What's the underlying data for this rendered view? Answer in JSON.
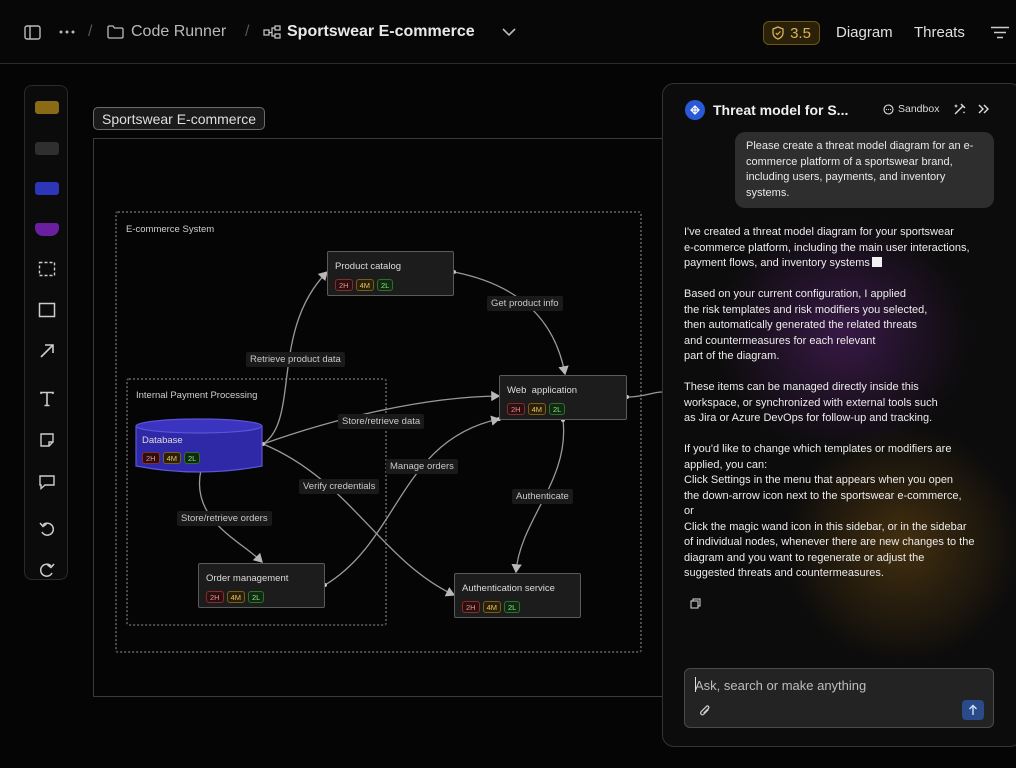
{
  "breadcrumb": {
    "workspace": "Code Runner",
    "project": "Sportswear E-commerce"
  },
  "header": {
    "score": "3.5",
    "nav_diagram": "Diagram",
    "nav_threats": "Threats"
  },
  "toolbar": {
    "swatch_colors": [
      "#8a6a14",
      "#2f2f2f",
      "#2d35b8",
      "#6a1fa0"
    ]
  },
  "canvas": {
    "frame_label": "Sportswear E-commerce",
    "boundaries": {
      "ecommerce": "E-commerce System",
      "payment": "Internal Payment Processing"
    },
    "nodes": {
      "product_catalog": {
        "title": "Product catalog",
        "high": "2H",
        "medium": "4M",
        "low": "2L"
      },
      "web_application": {
        "title": "Web  application",
        "high": "2H",
        "medium": "4M",
        "low": "2L"
      },
      "database": {
        "title": "Database",
        "high": "2H",
        "medium": "4M",
        "low": "2L"
      },
      "order_management": {
        "title": "Order management",
        "high": "2H",
        "medium": "4M",
        "low": "2L"
      },
      "authentication_service": {
        "title": "Authentication service",
        "high": "2H",
        "medium": "4M",
        "low": "2L"
      }
    },
    "edges": {
      "retrieve_product_data": "Retrieve product data",
      "get_product_info": "Get product info",
      "store_retrieve_data": "Store/retrieve data",
      "manage_orders": "Manage orders",
      "verify_credentials": "Verify credentials",
      "authenticate": "Authenticate",
      "store_retrieve_orders": "Store/retrieve orders"
    }
  },
  "chat": {
    "title": "Threat model for S...",
    "sandbox_label": "Sandbox",
    "user_message": "Please create a threat model diagram for an e-commerce platform of a sportswear brand, including users, payments, and inventory systems.",
    "reply": {
      "p1": [
        "I've created a threat model diagram for your sportswear",
        "e-commerce platform, including the main user interactions,",
        "payment flows, and inventory systems"
      ],
      "p2": [
        "Based on your current configuration, I applied",
        "the risk templates and risk modifiers you selected,",
        "then automatically generated the related threats",
        "and countermeasures for each relevant",
        "part of the diagram."
      ],
      "p3": [
        "These items can be managed directly inside this",
        "workspace, or synchronized with external tools such",
        "as Jira or Azure DevOps for follow-up and tracking."
      ],
      "p4": [
        "If you'd like to change which templates or modifiers are",
        "applied, you can:",
        "Click Settings in the menu that appears when you open",
        "the down-arrow icon next to the sportswear e-commerce,",
        "or",
        "Click the magic wand icon in this sidebar, or in the sidebar",
        "of individual nodes, whenever there are new changes to the",
        "diagram and you want to regenerate or adjust the",
        "suggested threats and countermeasures."
      ]
    },
    "input_placeholder": "Ask, search or make anything"
  }
}
